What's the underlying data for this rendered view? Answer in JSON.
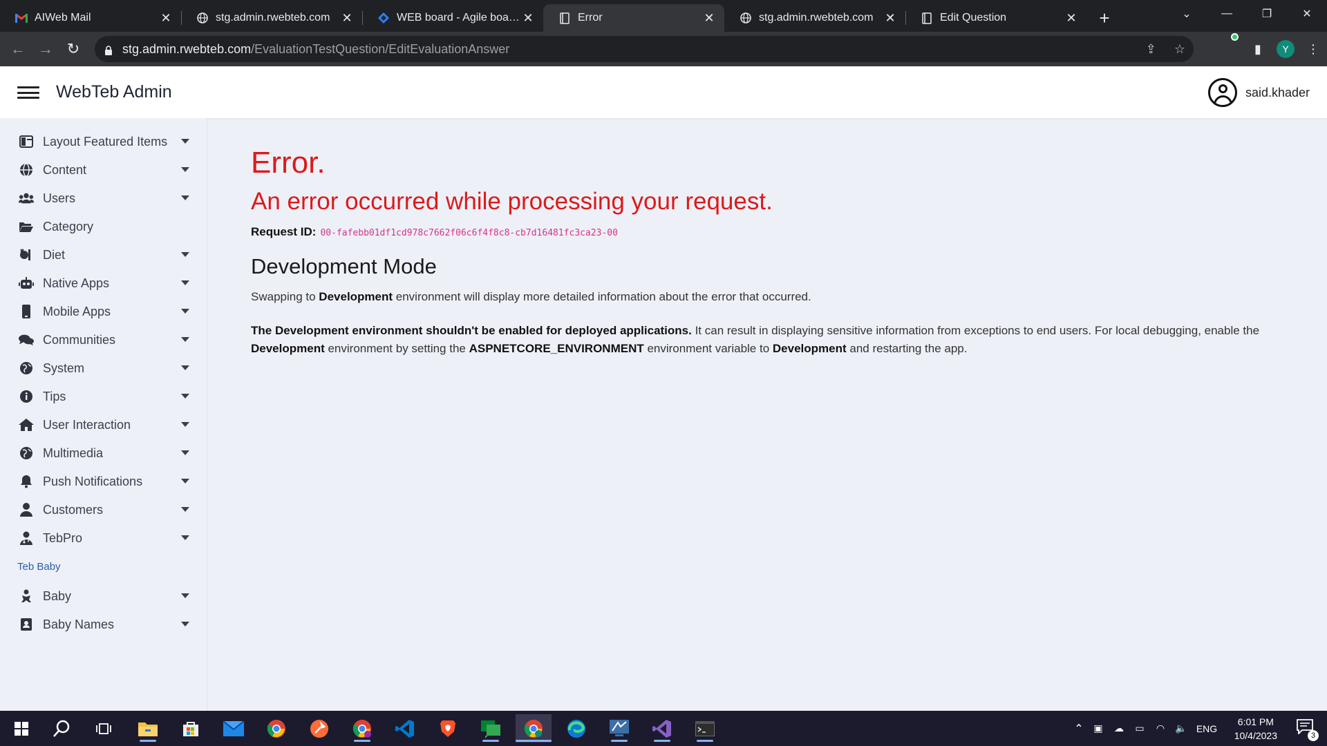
{
  "browser": {
    "tabs": [
      {
        "title": "AIWeb Mail",
        "icon": "gmail-icon"
      },
      {
        "title": "stg.admin.rwebteb.com",
        "icon": "globe-icon"
      },
      {
        "title": "WEB board - Agile board -",
        "icon": "jira-icon"
      },
      {
        "title": "Error",
        "icon": "page-icon",
        "active": true
      },
      {
        "title": "stg.admin.rwebteb.com",
        "icon": "globe-icon"
      },
      {
        "title": "Edit Question",
        "icon": "page-icon"
      }
    ],
    "url_host": "stg.admin.rwebteb.com",
    "url_path": "/EvaluationTestQuestion/EditEvaluationAnswer",
    "profile_initial": "Y"
  },
  "app": {
    "brand": "WebTeb Admin",
    "username": "said.khader"
  },
  "sidebar": {
    "items": [
      {
        "label": "Layout Featured Items",
        "icon": "layout-icon",
        "caret": true
      },
      {
        "label": "Content",
        "icon": "globe-icon",
        "caret": true
      },
      {
        "label": "Users",
        "icon": "users-icon",
        "caret": true
      },
      {
        "label": "Category",
        "icon": "folder-open-icon",
        "caret": false
      },
      {
        "label": "Diet",
        "icon": "diet-icon",
        "caret": true
      },
      {
        "label": "Native Apps",
        "icon": "robot-icon",
        "caret": true
      },
      {
        "label": "Mobile Apps",
        "icon": "mobile-icon",
        "caret": true
      },
      {
        "label": "Communities",
        "icon": "comments-icon",
        "caret": true
      },
      {
        "label": "System",
        "icon": "globe-icon",
        "caret": true
      },
      {
        "label": "Tips",
        "icon": "info-icon",
        "caret": true
      },
      {
        "label": "User Interaction",
        "icon": "home-icon",
        "caret": true
      },
      {
        "label": "Multimedia",
        "icon": "globe-icon",
        "caret": true
      },
      {
        "label": "Push Notifications",
        "icon": "bell-icon",
        "caret": true
      },
      {
        "label": "Customers",
        "icon": "user-icon",
        "caret": true
      },
      {
        "label": "TebPro",
        "icon": "user-doctor-icon",
        "caret": true
      }
    ],
    "section_label": "Teb Baby",
    "baby_items": [
      {
        "label": "Baby",
        "icon": "baby-icon",
        "caret": true
      },
      {
        "label": "Baby Names",
        "icon": "id-card-icon",
        "caret": true
      }
    ]
  },
  "error": {
    "title": "Error.",
    "subtitle": "An error occurred while processing your request.",
    "request_label": "Request ID:",
    "request_id": "00-fafebb01df1cd978c7662f06c6f4f8c8-cb7d16481fc3ca23-00",
    "dev_heading": "Development Mode",
    "p1_a": "Swapping to ",
    "p1_b": "Development",
    "p1_c": " environment will display more detailed information about the error that occurred.",
    "p2_a": "The Development environment shouldn't be enabled for deployed applications.",
    "p2_b": " It can result in displaying sensitive information from exceptions to end users. For local debugging, enable the ",
    "p2_c": "Development",
    "p2_d": " environment by setting the ",
    "p2_e": "ASPNETCORE_ENVIRONMENT",
    "p2_f": " environment variable to ",
    "p2_g": "Development",
    "p2_h": " and restarting the app."
  },
  "taskbar": {
    "language": "ENG",
    "time": "6:01 PM",
    "date": "10/4/2023",
    "notifications": "3"
  },
  "colors": {
    "error_red": "#dc1a1a",
    "request_id_pink": "#d63384",
    "section_blue": "#2b5ea8",
    "online_green": "#2ecc71"
  }
}
